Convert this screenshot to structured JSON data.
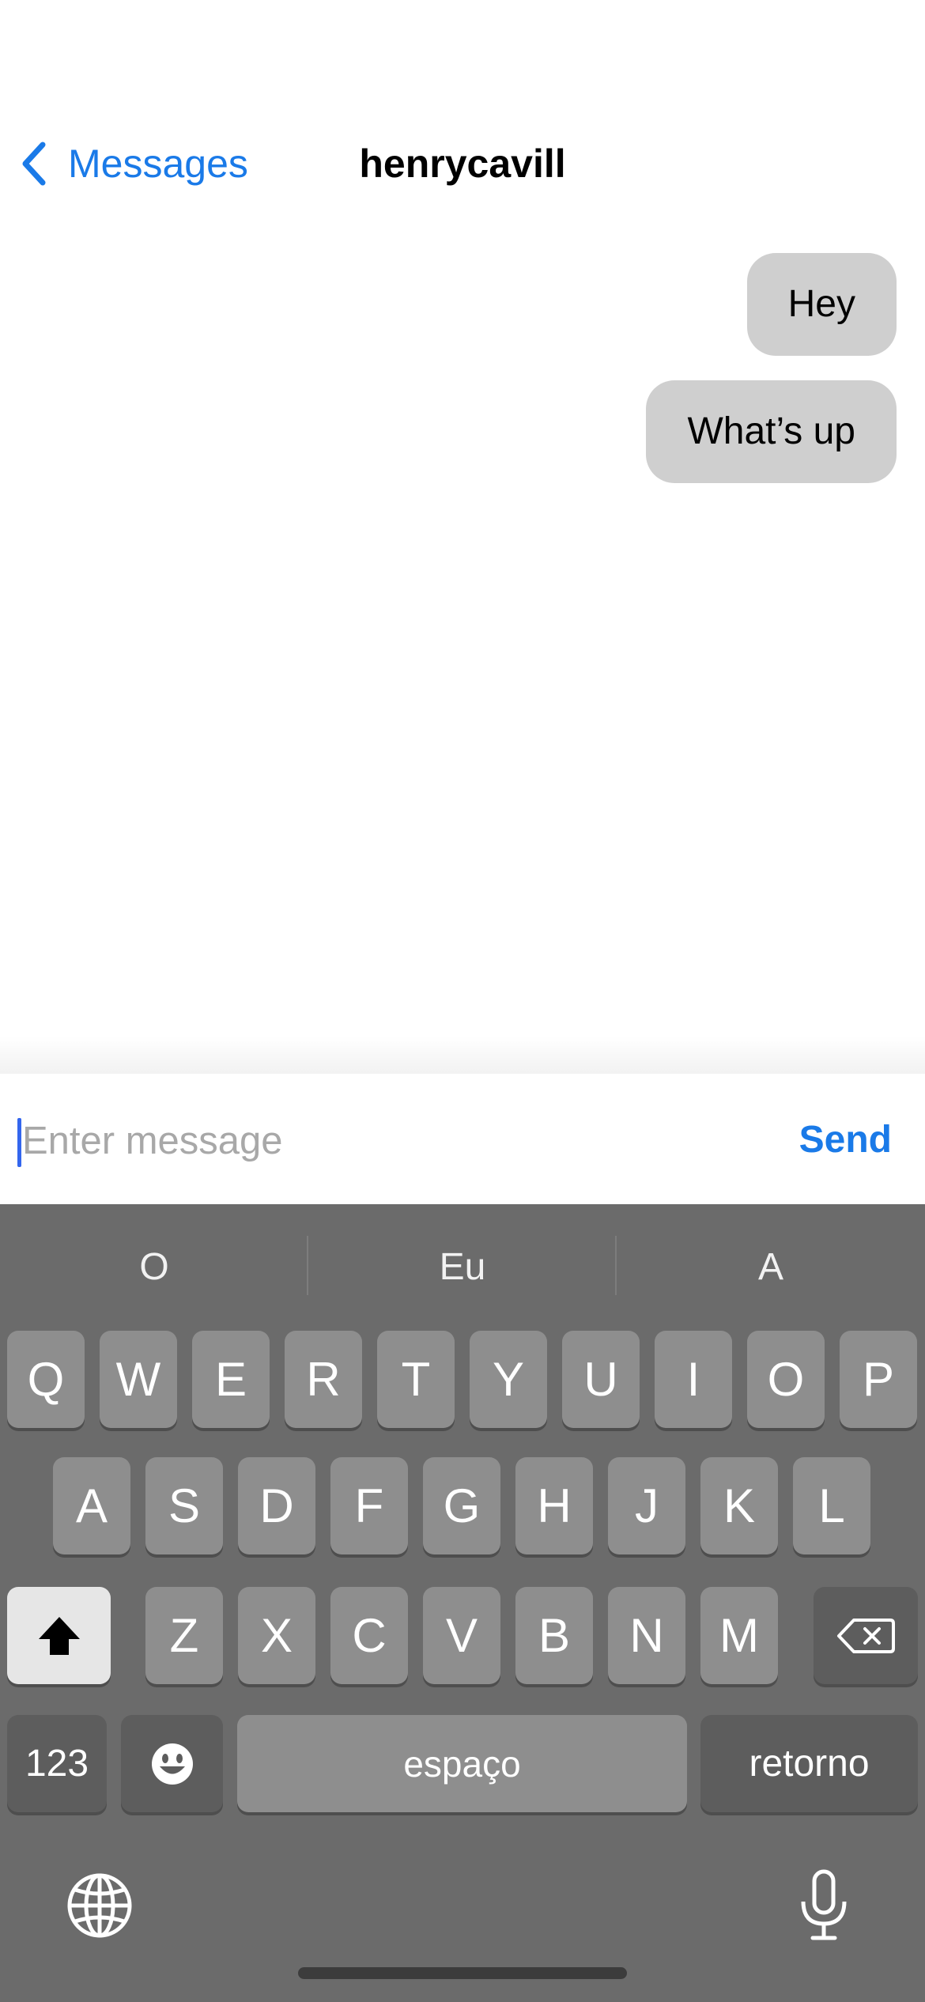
{
  "nav": {
    "back_label": "Messages",
    "title": "henrycavill"
  },
  "messages": [
    {
      "text": "Hey",
      "direction": "outgoing"
    },
    {
      "text": "What’s up",
      "direction": "outgoing"
    }
  ],
  "composer": {
    "placeholder": "Enter message",
    "value": "",
    "send_label": "Send"
  },
  "keyboard": {
    "suggestions": [
      "O",
      "Eu",
      "A"
    ],
    "row1": [
      "Q",
      "W",
      "E",
      "R",
      "T",
      "Y",
      "U",
      "I",
      "O",
      "P"
    ],
    "row2": [
      "A",
      "S",
      "D",
      "F",
      "G",
      "H",
      "J",
      "K",
      "L"
    ],
    "row3": [
      "Z",
      "X",
      "C",
      "V",
      "B",
      "N",
      "M"
    ],
    "numbers_label": "123",
    "space_label": "espaço",
    "return_label": "retorno",
    "shift_icon": "shift-icon",
    "delete_icon": "delete-icon",
    "emoji_icon": "emoji-icon",
    "globe_icon": "globe-icon",
    "mic_icon": "microphone-icon"
  },
  "colors": {
    "accent": "#1a7ae8",
    "bubble": "#cfcfcf",
    "keyboard_bg": "#6b6b6b",
    "key_bg": "#8e8e8e",
    "func_key_bg": "#5d5d5d"
  }
}
